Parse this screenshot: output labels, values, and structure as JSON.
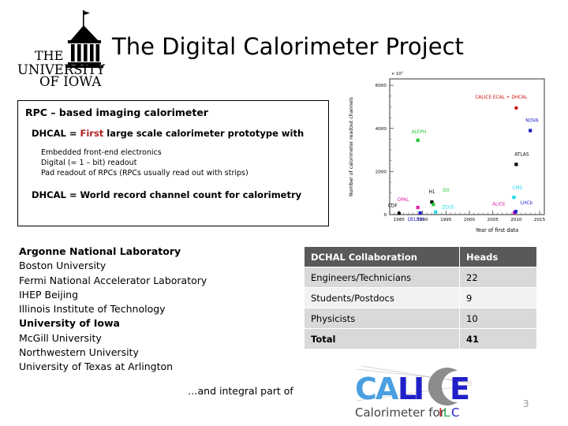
{
  "slide": {
    "title": "The Digital Calorimeter Project",
    "page_number": "3",
    "logo_name": "university-of-iowa-logo",
    "logo_lines": [
      "THE",
      "UNIVERSITY",
      "OF IOWA"
    ]
  },
  "textbox": {
    "heading": "RPC – based imaging calorimeter",
    "sub_prefix": "DHCAL = ",
    "sub_highlight": "First",
    "sub_suffix": " large scale calorimeter prototype with",
    "highlight_color": "#b02020",
    "bullets": [
      "Embedded front-end electronics",
      "Digital (= 1 – bit) readout",
      "Pad readout  of RPCs (RPCs usually read out with strips)"
    ],
    "footer": "DHCAL = World record channel count for calorimetry"
  },
  "institutions": [
    {
      "name": "Argonne National Laboratory",
      "bold": true
    },
    {
      "name": "Boston University",
      "bold": false
    },
    {
      "name": "Fermi National Accelerator Laboratory",
      "bold": false
    },
    {
      "name": "IHEP Beijing",
      "bold": false
    },
    {
      "name": "Illinois Institute of Technology",
      "bold": false
    },
    {
      "name": "University of Iowa",
      "bold": true
    },
    {
      "name": "McGill University",
      "bold": false
    },
    {
      "name": "Northwestern University",
      "bold": false
    },
    {
      "name": "University of Texas at Arlington",
      "bold": false
    }
  ],
  "table": {
    "headers": [
      "DCHAL Collaboration",
      "Heads"
    ],
    "rows": [
      {
        "label": "Engineers/Technicians",
        "value": "22"
      },
      {
        "label": "Students/Postdocs",
        "value": "9"
      },
      {
        "label": "Physicists",
        "value": "10"
      },
      {
        "label": "Total",
        "value": "41"
      }
    ],
    "header_bg": "#595959",
    "row_bg_shade": "#d9d9d9",
    "row_bg_light": "#f2f2f2"
  },
  "footer": {
    "note": "…and integral part of",
    "calice_logo": {
      "letters": [
        {
          "char": "C",
          "color": "#4a9fe0"
        },
        {
          "char": "A",
          "color": "#4a9fe0"
        },
        {
          "char": "L",
          "color": "#2020c8"
        },
        {
          "char": "I",
          "color": "#2020c8"
        },
        {
          "char": "C",
          "color": "#8c8c8c"
        },
        {
          "char": "E",
          "color": "#2020c8"
        }
      ],
      "tagline_prefix": "Calorimeter for ",
      "tagline_i": "I",
      "tagline_l": "L",
      "tagline_c": "C",
      "tagline_i_color": "#cc2222",
      "tagline_l_color": "#22aa44",
      "tagline_c_color": "#2222cc"
    }
  },
  "chart_data": {
    "type": "scatter",
    "title": "",
    "xlabel": "Year of first data",
    "ylabel": "Number of calorimeter readout channels",
    "y_multiplier": "× 10",
    "y_multiplier_exp": "2",
    "xlim": [
      1983,
      2016
    ],
    "ylim": [
      0,
      6300
    ],
    "xticks": [
      "1985",
      "1990",
      "1995",
      "2000",
      "2005",
      "2010",
      "2015"
    ],
    "xtick_values": [
      1985,
      1990,
      1995,
      2000,
      2005,
      2010,
      2015
    ],
    "yticks": [
      "0",
      "2000",
      "4000",
      "6000"
    ],
    "ytick_values": [
      0,
      2000,
      4000,
      6000
    ],
    "grid": false,
    "legend": "none",
    "points": [
      {
        "name": "CDF",
        "x": 1985,
        "y": 60,
        "color": "#000000",
        "label_dx": -14,
        "label_dy": -8
      },
      {
        "name": "OPAL",
        "x": 1989,
        "y": 330,
        "color": "#e020b0",
        "label_dx": -26,
        "label_dy": -8
      },
      {
        "name": "DELPHI",
        "x": 1989.5,
        "y": 75,
        "color": "#2020c8",
        "label_dx": -16,
        "label_dy": 10
      },
      {
        "name": "ALEPH",
        "x": 1989,
        "y": 3450,
        "color": "#22c832",
        "label_dx": -8,
        "label_dy": -9
      },
      {
        "name": "H1",
        "x": 1992,
        "y": 580,
        "color": "#000000",
        "label_dx": -4,
        "label_dy": -11
      },
      {
        "name": "D0",
        "x": 1992.3,
        "y": 470,
        "color": "#22c832",
        "label_dx": 12,
        "label_dy": -16
      },
      {
        "name": "ZEUS",
        "x": 1992.8,
        "y": 120,
        "color": "#22d8e8",
        "label_dx": 8,
        "label_dy": -4
      },
      {
        "name": "ATLAS",
        "x": 2010,
        "y": 2330,
        "color": "#000000",
        "label_dx": -2,
        "label_dy": -11
      },
      {
        "name": "CMS",
        "x": 2009.5,
        "y": 800,
        "color": "#22d8e8",
        "label_dx": -2,
        "label_dy": -10
      },
      {
        "name": "ALICE",
        "x": 2009.6,
        "y": 90,
        "color": "#e020b0",
        "label_dx": -28,
        "label_dy": -9
      },
      {
        "name": "LHCb",
        "x": 2009.9,
        "y": 140,
        "color": "#2020c8",
        "label_dx": 6,
        "label_dy": -9
      },
      {
        "name": "NOVA",
        "x": 2013,
        "y": 3900,
        "color": "#2020c8",
        "label_dx": -6,
        "label_dy": -11
      },
      {
        "name": "CALICE ECAL + DHCAL",
        "x": 2010,
        "y": 4950,
        "color": "#cc1111",
        "label_dx": -52,
        "label_dy": -12
      }
    ]
  }
}
